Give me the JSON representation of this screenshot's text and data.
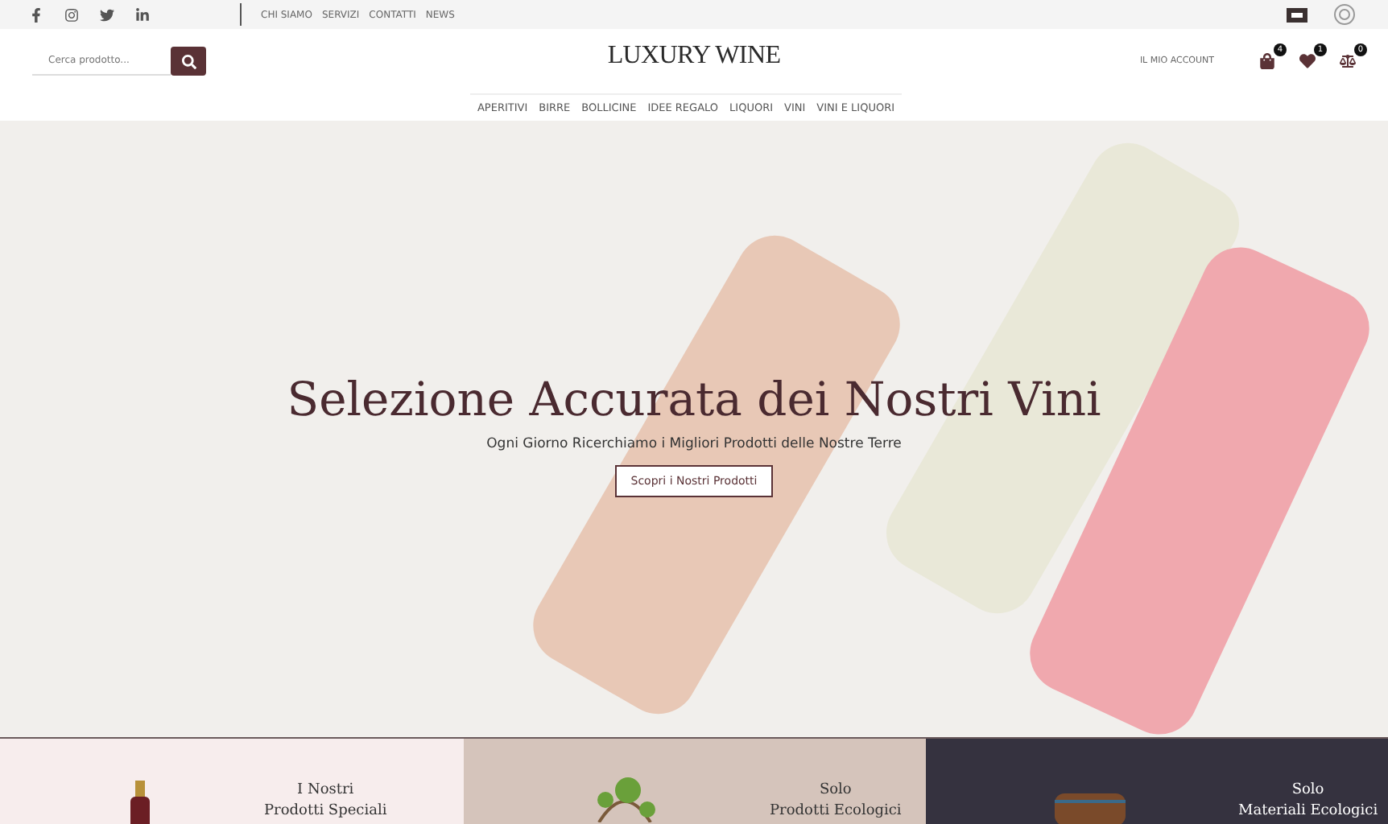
{
  "topbar": {
    "social": [
      {
        "kind": "facebook"
      },
      {
        "kind": "instagram"
      },
      {
        "kind": "twitter"
      },
      {
        "kind": "linkedin"
      }
    ],
    "links": [
      "CHI SIAMO",
      "SERVIZI",
      "CONTATTI",
      "NEWS"
    ]
  },
  "header": {
    "search": {
      "placeholder": "Cerca prodotto..."
    },
    "logo": "LUXURY WINE",
    "account": "IL MIO ACCOUNT",
    "counters": [
      {
        "kind": "bag",
        "count": "4"
      },
      {
        "kind": "heart",
        "count": "1"
      },
      {
        "kind": "scale",
        "count": "0"
      }
    ]
  },
  "nav": [
    "APERITIVI",
    "BIRRE",
    "BOLLICINE",
    "IDEE REGALO",
    "LIQUORI",
    "VINI",
    "VINI E LIQUORI"
  ],
  "hero": {
    "title": "Selezione Accurata dei Nostri Vini",
    "subtitle": "Ogni Giorno Ricerchiamo i Migliori Prodotti delle Nostre Terre",
    "button": "Scopri i Nostri Prodotti"
  },
  "features": [
    {
      "kind": "bottle",
      "color": "#f7eded",
      "line1": "I Nostri",
      "line2": "Prodotti Speciali"
    },
    {
      "kind": "vine",
      "color": "#d5c4bb",
      "line1": "Solo",
      "line2": "Prodotti Ecologici"
    },
    {
      "kind": "barrel",
      "color": "#35323f",
      "line1": "Solo",
      "line2": "Materiali Ecologici"
    }
  ]
}
